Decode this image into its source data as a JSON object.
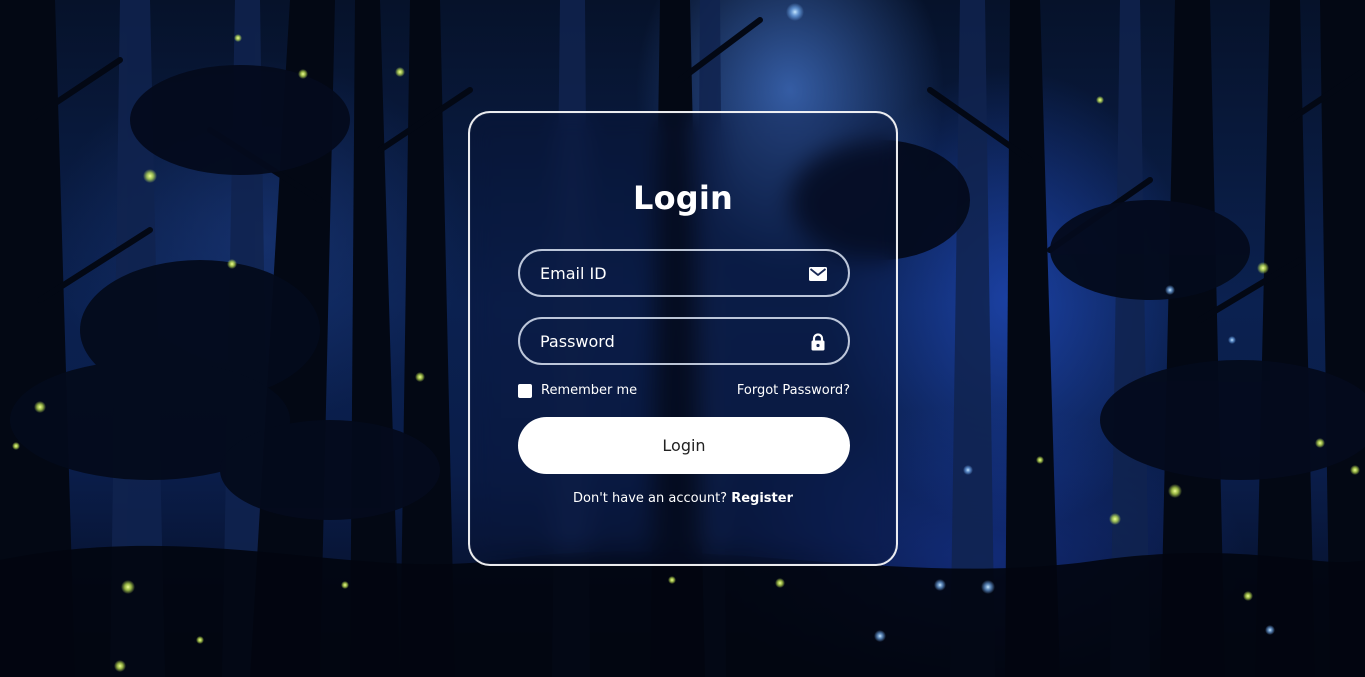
{
  "login": {
    "title": "Login",
    "email": {
      "placeholder": "Email ID",
      "icon": "envelope-icon"
    },
    "password": {
      "placeholder": "Password",
      "icon": "lock-icon"
    },
    "remember_label": "Remember me",
    "remember_checked": false,
    "forgot_label": "Forgot Password?",
    "submit_label": "Login",
    "register_prompt": "Don't have an account?",
    "register_label": "Register"
  },
  "colors": {
    "card_border": "#ffffff",
    "button_background": "#ffffff",
    "background_deep": "#06122a",
    "background_glow": "#2a5ae6",
    "firefly": "#d8ff5a"
  }
}
